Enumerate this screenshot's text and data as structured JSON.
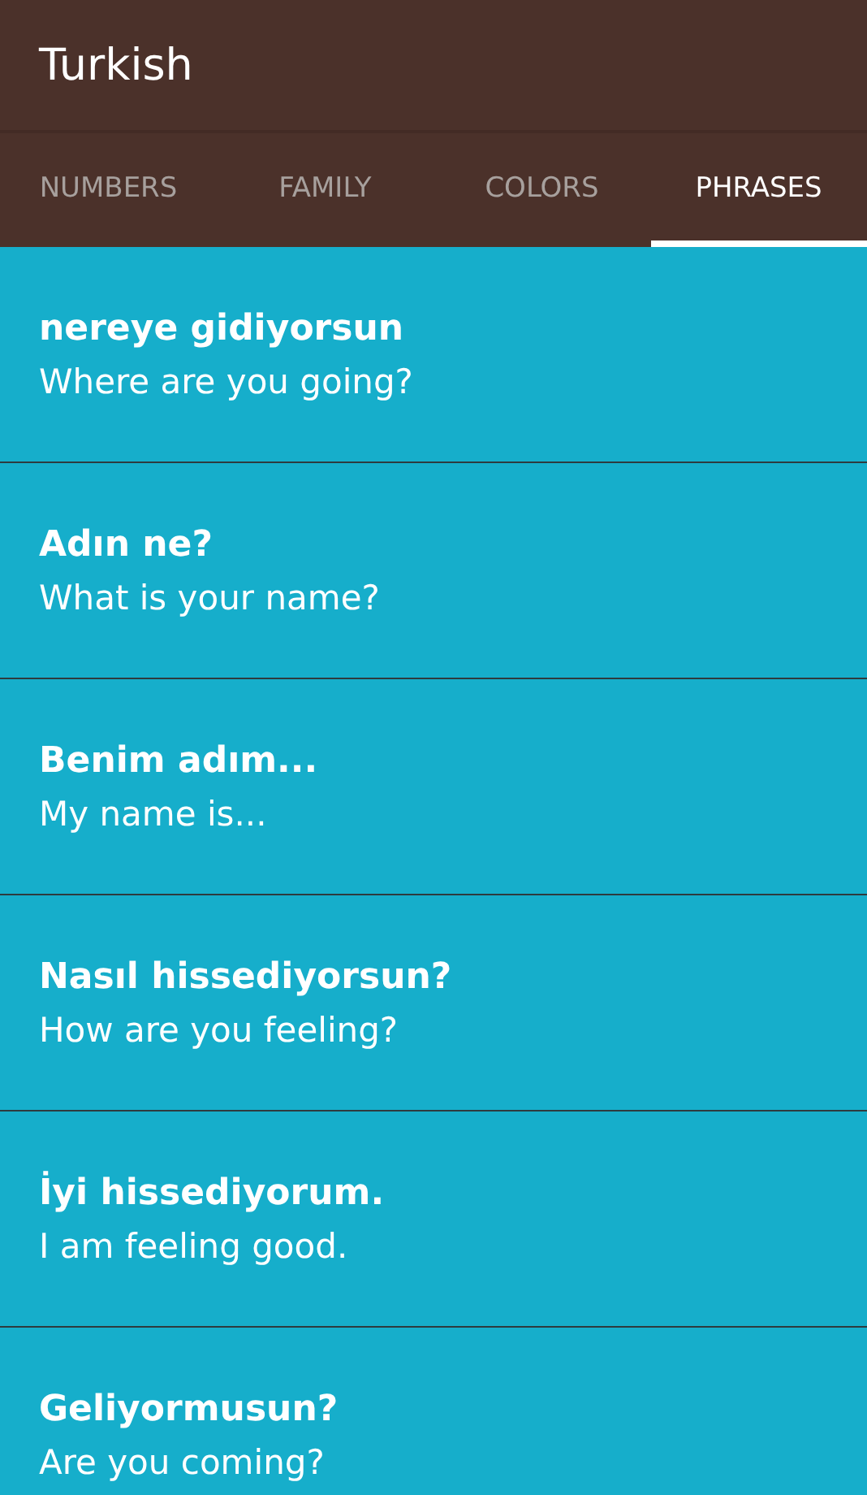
{
  "app_bar": {
    "title": "Turkish"
  },
  "tabs": [
    {
      "label": "NUMBERS",
      "selected": false
    },
    {
      "label": "FAMILY",
      "selected": false
    },
    {
      "label": "COLORS",
      "selected": false
    },
    {
      "label": "PHRASES",
      "selected": true
    }
  ],
  "phrases": [
    {
      "turkish": "nereye gidiyorsun",
      "english": "Where are you going?"
    },
    {
      "turkish": "Adın ne?",
      "english": "What is your name?"
    },
    {
      "turkish": "Benim adım...",
      "english": "My name is..."
    },
    {
      "turkish": "Nasıl hissediyorsun?",
      "english": "How are you feeling?"
    },
    {
      "turkish": "İyi hissediyorum.",
      "english": "I am feeling good."
    },
    {
      "turkish": "Geliyormusun?",
      "english": "Are you coming?"
    }
  ]
}
